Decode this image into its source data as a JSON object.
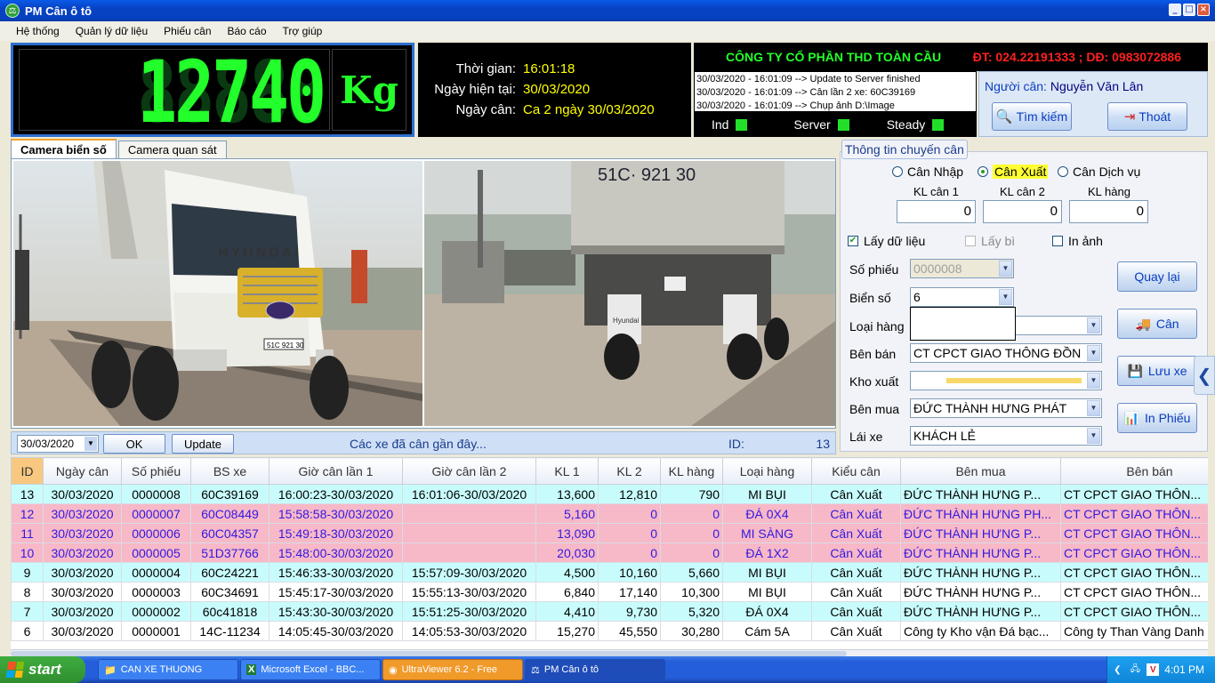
{
  "window": {
    "title": "PM Cân ô tô",
    "minimize": "_",
    "maximize": "□",
    "close": "×"
  },
  "menu": [
    "Hệ thống",
    "Quản lý dữ liệu",
    "Phiếu cân",
    "Báo cáo",
    "Trợ giúp"
  ],
  "weight": {
    "ghost": "88888",
    "value": "12740",
    "unit": "Kg"
  },
  "time": [
    {
      "label": "Thời gian:",
      "value": "16:01:18"
    },
    {
      "label": "Ngày hiện tại:",
      "value": "30/03/2020"
    },
    {
      "label": "Ngày cân:",
      "value": "Ca 2 ngày 30/03/2020"
    }
  ],
  "company": {
    "name": "CÔNG TY CỔ PHẦN THD TOÀN CẦU",
    "phone": "ĐT: 024.22191333 ; DĐ: 0983072886"
  },
  "log": [
    "30/03/2020 - 16:01:09 --> Update to Server finished",
    "30/03/2020 - 16:01:09 --> Cân lần 2 xe: 60C39169",
    "30/03/2020 - 16:01:09 --> Chụp ảnh D:\\Image"
  ],
  "status": [
    {
      "label": "Ind"
    },
    {
      "label": "Server"
    },
    {
      "label": "Steady"
    }
  ],
  "user": {
    "label": "Người cân:",
    "name": "Nguyễn Văn Lân",
    "search": "Tìm kiếm",
    "exit": "Thoát"
  },
  "tabs": [
    "Camera biển số",
    "Camera quan sát"
  ],
  "camera": {
    "plate_front": "51C 921 30",
    "plate_top": "51C· 921 30",
    "brand": "HYUNDAI",
    "mudflap": "Hyundai"
  },
  "recent": {
    "date": "30/03/2020",
    "ok": "OK",
    "update": "Update",
    "label": "Các xe đã cân gần đây...",
    "id_label": "ID:",
    "id_value": "13"
  },
  "form": {
    "title": "Thông tin chuyến cân",
    "radios": [
      "Cân Nhập",
      "Cân Xuất",
      "Cân Dịch vụ"
    ],
    "kl_labels": [
      "KL cân 1",
      "KL cân 2",
      "KL hàng"
    ],
    "kl_values": [
      "0",
      "0",
      "0"
    ],
    "checks": [
      "Lấy dữ liệu",
      "Lấy bì",
      "In ảnh"
    ],
    "fields": [
      {
        "label": "Số phiếu",
        "value": "0000008"
      },
      {
        "label": "Biển số",
        "value": "6"
      },
      {
        "label": "Loại hàng",
        "value": ""
      },
      {
        "label": "Bên bán",
        "value": "CT CPCT GIAO THÔNG ĐỒN"
      },
      {
        "label": "Kho xuất",
        "value": ""
      },
      {
        "label": "Bên mua",
        "value": "ĐỨC THÀNH HƯNG PHÁT"
      },
      {
        "label": "Lái xe",
        "value": "KHÁCH LẺ"
      }
    ],
    "buttons": [
      "Quay lại",
      "Cân",
      "Lưu xe",
      "In Phiếu"
    ]
  },
  "table": {
    "headers": [
      "ID",
      "Ngày cân",
      "Số phiếu",
      "BS xe",
      "Giờ cân lần 1",
      "Giờ cân lần 2",
      "KL 1",
      "KL 2",
      "KL hàng",
      "Loại hàng",
      "Kiểu cân",
      "Bên mua",
      "Bên bán"
    ],
    "rows": [
      {
        "style": "cyan",
        "cells": [
          "13",
          "30/03/2020",
          "0000008",
          "60C39169",
          "16:00:23-30/03/2020",
          "16:01:06-30/03/2020",
          "13,600",
          "12,810",
          "790",
          "MI BỤI",
          "Cân Xuất",
          "ĐỨC THÀNH HƯNG P...",
          "CT CPCT GIAO THÔN..."
        ]
      },
      {
        "style": "pink",
        "cells": [
          "12",
          "30/03/2020",
          "0000007",
          "60C08449",
          "15:58:58-30/03/2020",
          "",
          "5,160",
          "0",
          "0",
          "ĐÁ 0X4",
          "Cân Xuất",
          "ĐỨC THÀNH HƯNG PH...",
          "CT CPCT GIAO THÔN..."
        ]
      },
      {
        "style": "pink",
        "cells": [
          "11",
          "30/03/2020",
          "0000006",
          "60C04357",
          "15:49:18-30/03/2020",
          "",
          "13,090",
          "0",
          "0",
          "MI SÀNG",
          "Cân Xuất",
          "ĐỨC THÀNH HƯNG P...",
          "CT CPCT GIAO THÔN..."
        ]
      },
      {
        "style": "pink",
        "cells": [
          "10",
          "30/03/2020",
          "0000005",
          "51D37766",
          "15:48:00-30/03/2020",
          "",
          "20,030",
          "0",
          "0",
          "ĐÁ 1X2",
          "Cân Xuất",
          "ĐỨC THÀNH HƯNG P...",
          "CT CPCT GIAO THÔN..."
        ]
      },
      {
        "style": "cyan",
        "cells": [
          "9",
          "30/03/2020",
          "0000004",
          "60C24221",
          "15:46:33-30/03/2020",
          "15:57:09-30/03/2020",
          "4,500",
          "10,160",
          "5,660",
          "MI BỤI",
          "Cân Xuất",
          "ĐỨC THÀNH HƯNG P...",
          "CT CPCT GIAO THÔN..."
        ]
      },
      {
        "style": "white",
        "cells": [
          "8",
          "30/03/2020",
          "0000003",
          "60C34691",
          "15:45:17-30/03/2020",
          "15:55:13-30/03/2020",
          "6,840",
          "17,140",
          "10,300",
          "MI BỤI",
          "Cân Xuất",
          "ĐỨC THÀNH HƯNG P...",
          "CT CPCT GIAO THÔN..."
        ]
      },
      {
        "style": "cyan",
        "cells": [
          "7",
          "30/03/2020",
          "0000002",
          "60c41818",
          "15:43:30-30/03/2020",
          "15:51:25-30/03/2020",
          "4,410",
          "9,730",
          "5,320",
          "ĐÁ 0X4",
          "Cân Xuất",
          "ĐỨC THÀNH HƯNG P...",
          "CT CPCT GIAO THÔN..."
        ]
      },
      {
        "style": "white",
        "cells": [
          "6",
          "30/03/2020",
          "0000001",
          "14C-11234",
          "14:05:45-30/03/2020",
          "14:05:53-30/03/2020",
          "15,270",
          "45,550",
          "30,280",
          "Cám 5A",
          "Cân Xuất",
          "Công ty Kho vận Đá bạc...",
          "Công ty Than Vàng Danh"
        ]
      }
    ]
  },
  "taskbar": {
    "start": "start",
    "tasks": [
      "CAN XE THUONG",
      "Microsoft Excel - BBC...",
      "UltraViewer 6.2 - Free",
      "PM Cân ô tô"
    ],
    "clock": "4:01 PM"
  },
  "colors": {
    "digit": "#22ff2a",
    "company": "#22ff2a",
    "phone": "#ff2020",
    "pink_row": "#f7b8c8",
    "cyan_row": "#c8fcfc"
  }
}
